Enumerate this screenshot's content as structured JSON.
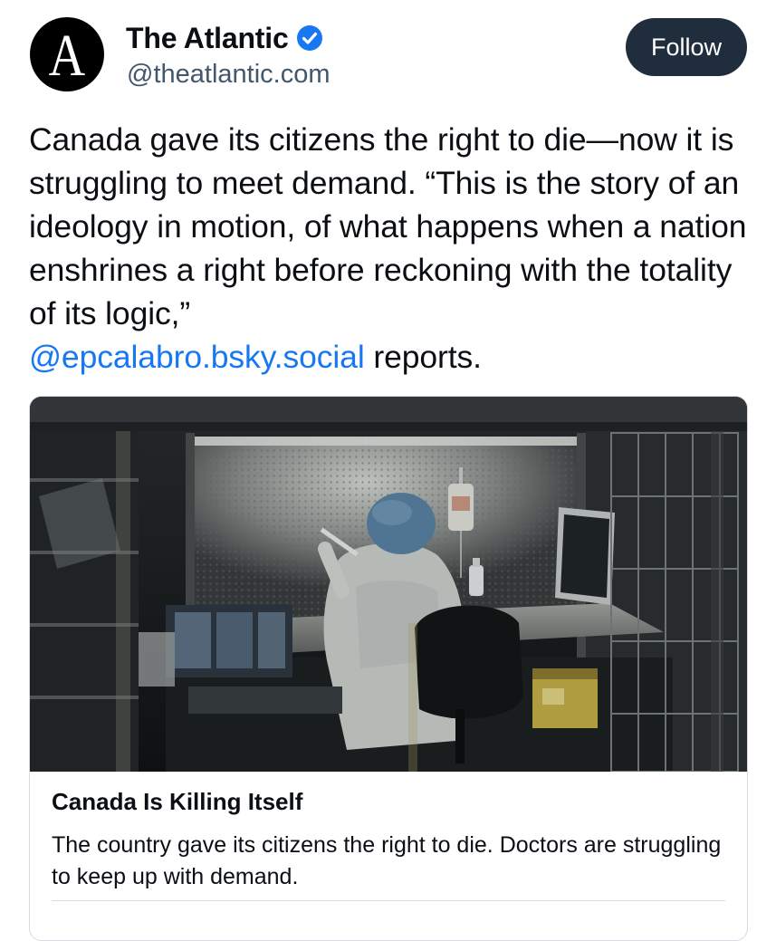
{
  "author": {
    "display_name": "The Atlantic",
    "handle": "@theatlantic.com",
    "avatar_letter": "A",
    "verified_icon": "verified-badge-icon",
    "verified_color": "#1877f2"
  },
  "actions": {
    "follow_label": "Follow"
  },
  "post": {
    "text": "Canada gave its citizens the right to die—now it is struggling to meet demand. “This is the story of an ideology in motion, of what happens when a nation enshrines a right before reckoning with the totality of its logic,”",
    "mention": "@epcalabro.bsky.social",
    "text_end": "reports."
  },
  "link_card": {
    "title": "Canada Is Killing Itself",
    "description": "The country gave its citizens the right to die. Doctors are struggling to keep up with demand."
  },
  "colors": {
    "link": "#1877f2",
    "follow_bg": "#1f2d3d",
    "handle": "#42576c"
  }
}
